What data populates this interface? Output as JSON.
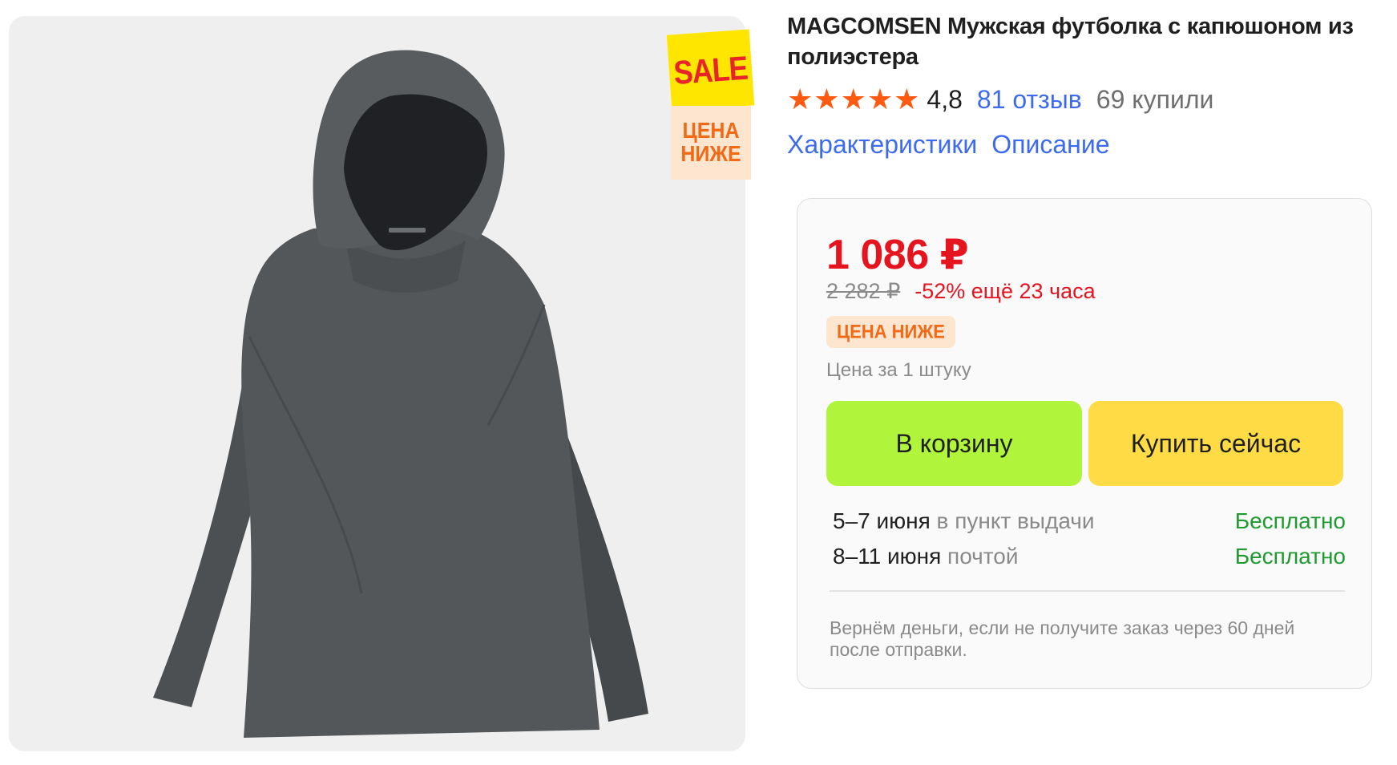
{
  "gallery": {
    "image_alt": "MAGCOMSEN Мужская футболка с капюшоном из полиэстера",
    "sticker": {
      "top_text": "SALE",
      "bottom_line1": "ЦЕНА",
      "bottom_line2": "НИЖЕ"
    }
  },
  "product": {
    "title": "MAGCOMSEN Мужская футболка с капюшоном из полиэстера",
    "rating": "4,8",
    "stars": 5,
    "reviews": "81 отзыв",
    "bought": "69 купили",
    "links": [
      "Характеристики",
      "Описание"
    ]
  },
  "buy_box": {
    "price": "1 086 ₽",
    "old_price": "2 282 ₽",
    "discount": "-52% ещё 23 часа",
    "badge": "ЦЕНА НИЖЕ",
    "unit_note": "Цена за 1 штуку",
    "cart_button": "В корзину",
    "buy_button": "Купить сейчас",
    "delivery": [
      {
        "date": "5–7 июня",
        "method": "в пункт выдачи",
        "cost": "Бесплатно"
      },
      {
        "date": "8–11 июня",
        "method": "почтой",
        "cost": "Бесплатно"
      }
    ],
    "guarantee": "Вернём деньги, если не получите заказ через 60 дней после отправки."
  },
  "colors": {
    "price_red": "#e6141e",
    "link_blue": "#3d6bf0",
    "star_orange": "#ff5a12",
    "cart_green": "#b1f43c",
    "buy_yellow": "#ffdc46",
    "free_green": "#1e9a2e"
  }
}
